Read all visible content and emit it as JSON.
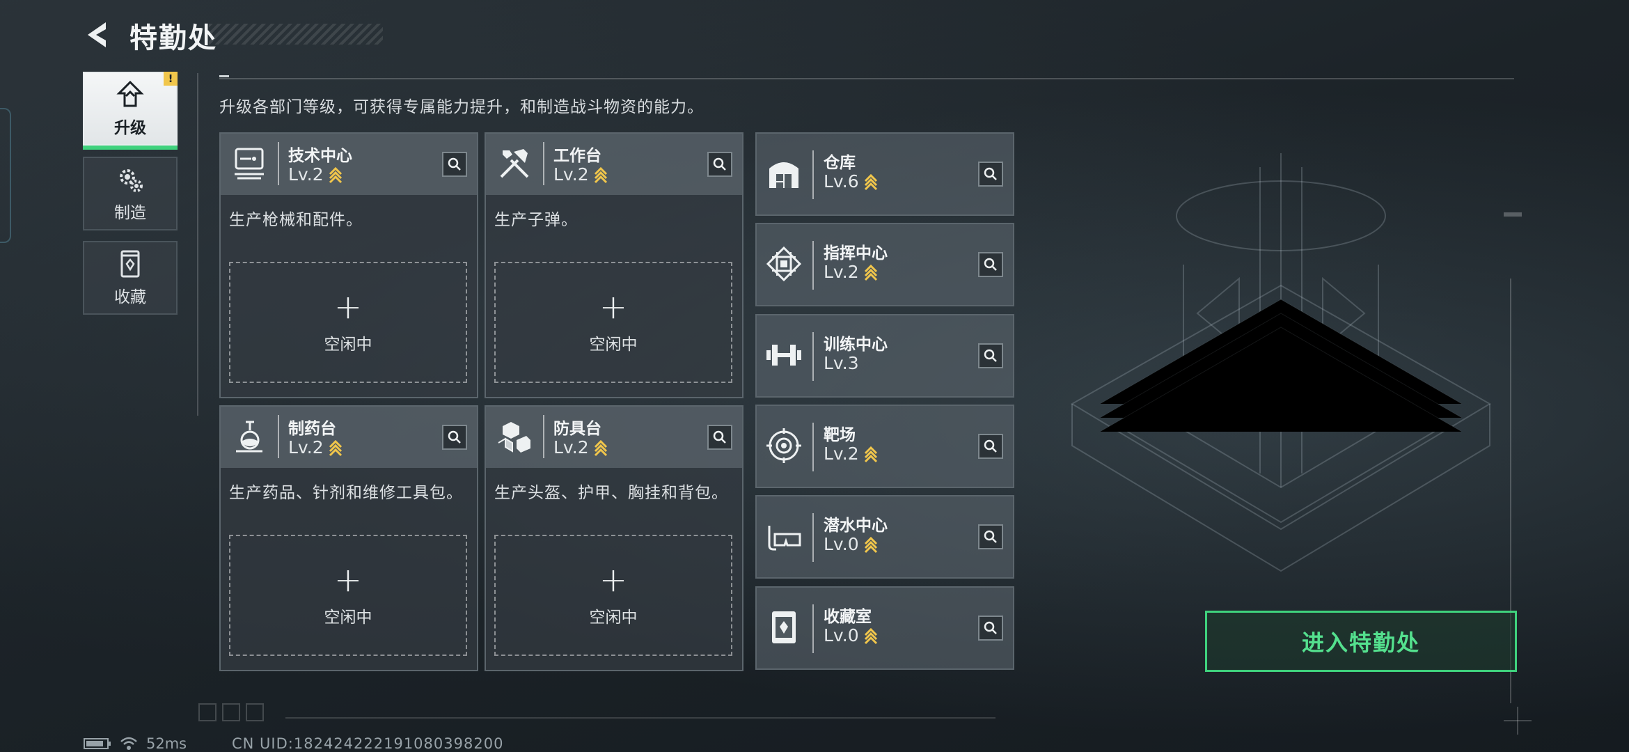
{
  "header": {
    "title": "特勤处"
  },
  "side_tabs": [
    {
      "label": "升级",
      "active": true,
      "badge": "!"
    },
    {
      "label": "制造"
    },
    {
      "label": "收藏"
    }
  ],
  "description": "升级各部门等级，可获得专属能力提升，和制造战斗物资的能力。",
  "departments_large": [
    {
      "name": "技术中心",
      "level": "Lv.2",
      "upgradable": true,
      "desc": "生产枪械和配件。",
      "slot_plus": "+",
      "slot_status": "空闲中",
      "icon": "tech-center-icon"
    },
    {
      "name": "工作台",
      "level": "Lv.2",
      "upgradable": true,
      "desc": "生产子弹。",
      "slot_plus": "+",
      "slot_status": "空闲中",
      "icon": "workbench-icon"
    },
    {
      "name": "制药台",
      "level": "Lv.2",
      "upgradable": true,
      "desc": "生产药品、针剂和维修工具包。",
      "slot_plus": "+",
      "slot_status": "空闲中",
      "icon": "pharmacy-icon"
    },
    {
      "name": "防具台",
      "level": "Lv.2",
      "upgradable": true,
      "desc": "生产头盔、护甲、胸挂和背包。",
      "slot_plus": "+",
      "slot_status": "空闲中",
      "icon": "armor-bench-icon"
    }
  ],
  "departments_small": [
    {
      "name": "仓库",
      "level": "Lv.6",
      "upgradable": true,
      "icon": "warehouse-icon"
    },
    {
      "name": "指挥中心",
      "level": "Lv.2",
      "upgradable": true,
      "icon": "command-center-icon"
    },
    {
      "name": "训练中心",
      "level": "Lv.3",
      "upgradable": false,
      "icon": "training-center-icon"
    },
    {
      "name": "靶场",
      "level": "Lv.2",
      "upgradable": true,
      "icon": "shooting-range-icon"
    },
    {
      "name": "潜水中心",
      "level": "Lv.0",
      "upgradable": true,
      "icon": "diving-center-icon"
    },
    {
      "name": "收藏室",
      "level": "Lv.0",
      "upgradable": true,
      "icon": "collection-room-icon"
    }
  ],
  "enter_button": "进入特勤处",
  "footer": {
    "ping": "52ms",
    "uid": "CN UID:1824242221910803982​00"
  },
  "colors": {
    "accent_green": "#3fd27d",
    "upgrade_gold": "#f1c64b",
    "background": "#1c2328"
  }
}
